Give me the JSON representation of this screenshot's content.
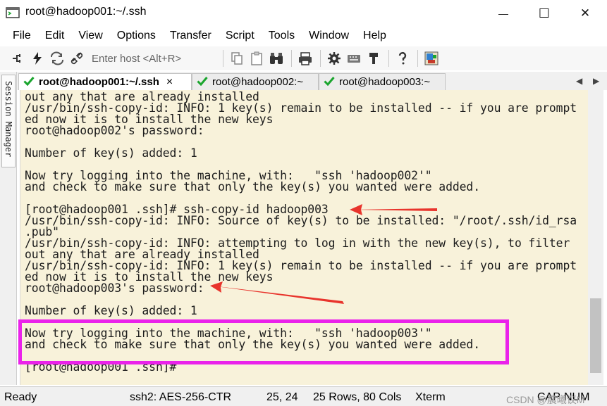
{
  "window": {
    "title": "root@hadoop001:~/.ssh",
    "minimize_symbol": "—",
    "maximize_symbol": "☐",
    "close_symbol": "✕"
  },
  "menu": [
    "File",
    "Edit",
    "View",
    "Options",
    "Transfer",
    "Script",
    "Tools",
    "Window",
    "Help"
  ],
  "toolbar": {
    "host_placeholder": "Enter host <Alt+R>",
    "icons": [
      "connect-icon",
      "quick-connect-icon",
      "reconnect-icon",
      "disconnect-icon",
      "copy-icon",
      "paste-icon",
      "find-icon",
      "print-icon",
      "settings-icon",
      "keymap-icon",
      "sftp-icon",
      "help-icon",
      "screen-icon"
    ]
  },
  "sidebar": {
    "label": "Session Manager"
  },
  "tabs": [
    {
      "label": "root@hadoop001:~/.ssh",
      "active": true,
      "close": "×"
    },
    {
      "label": "root@hadoop002:~",
      "active": false
    },
    {
      "label": "root@hadoop003:~",
      "active": false
    }
  ],
  "tab_nav": {
    "prev": "◀",
    "next": "▶"
  },
  "terminal": {
    "lines": [
      "out any that are already installed",
      "/usr/bin/ssh-copy-id: INFO: 1 key(s) remain to be installed -- if you are prompt",
      "ed now it is to install the new keys",
      "root@hadoop002's password:",
      "",
      "Number of key(s) added: 1",
      "",
      "Now try logging into the machine, with:   \"ssh 'hadoop002'\"",
      "and check to make sure that only the key(s) you wanted were added.",
      "",
      "[root@hadoop001 .ssh]# ssh-copy-id hadoop003",
      "/usr/bin/ssh-copy-id: INFO: Source of key(s) to be installed: \"/root/.ssh/id_rsa",
      ".pub\"",
      "/usr/bin/ssh-copy-id: INFO: attempting to log in with the new key(s), to filter",
      "out any that are already installed",
      "/usr/bin/ssh-copy-id: INFO: 1 key(s) remain to be installed -- if you are prompt",
      "ed now it is to install the new keys",
      "root@hadoop003's password:",
      "",
      "Number of key(s) added: 1",
      "",
      "Now try logging into the machine, with:   \"ssh 'hadoop003'\"",
      "and check to make sure that only the key(s) you wanted were added.",
      "",
      "[root@hadoop001 .ssh]#"
    ]
  },
  "status": {
    "ready": "Ready",
    "cipher": "ssh2: AES-256-CTR",
    "cursor": "25,  24",
    "size": "25 Rows, 80 Cols",
    "term": "Xterm",
    "caps": "CAP",
    "num": "NUM",
    "watermark": "CSDN @晨曦议M"
  },
  "colors": {
    "terminal_bg": "#f8f2da",
    "highlight": "#ea22ea",
    "arrow": "#e8342c",
    "check": "#1aa52e"
  }
}
